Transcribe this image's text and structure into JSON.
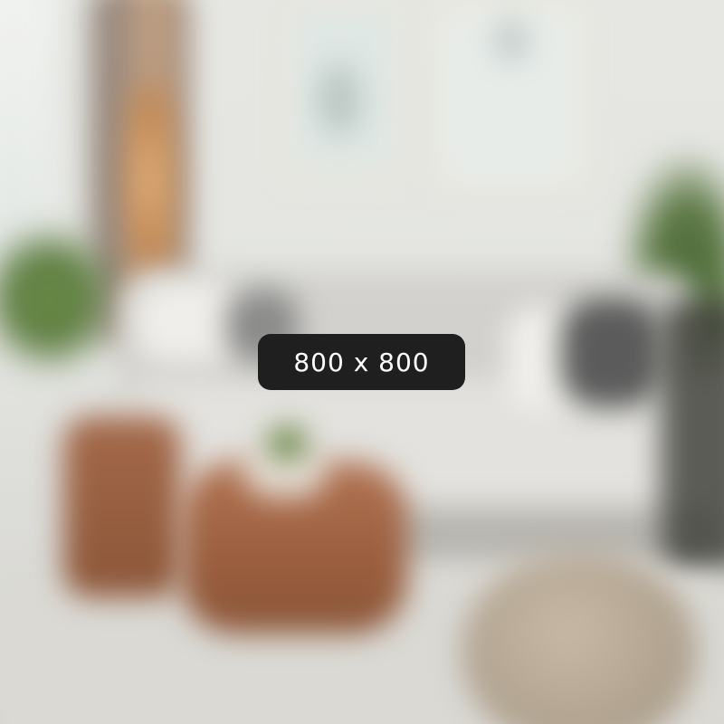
{
  "placeholder": {
    "label": "800 x 800"
  },
  "colors": {
    "badge_background": "#1f1f1f",
    "badge_text": "#ffffff"
  }
}
